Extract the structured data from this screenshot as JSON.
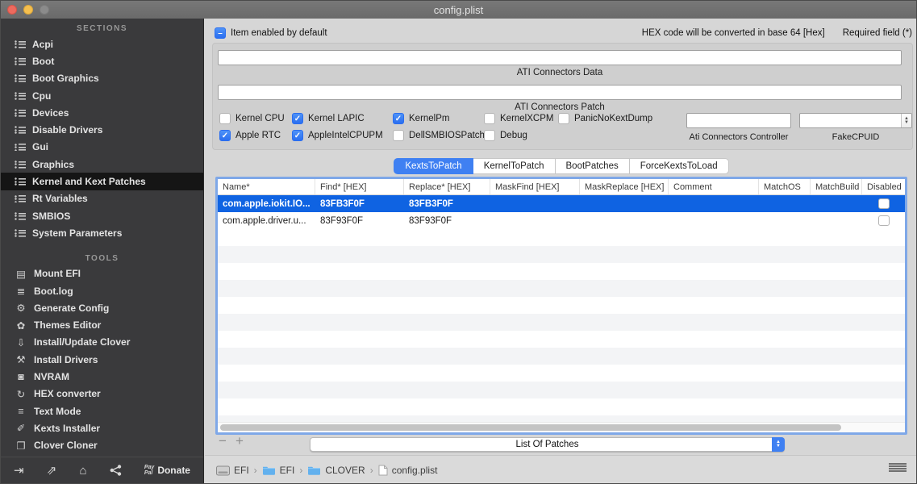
{
  "window": {
    "title": "config.plist"
  },
  "colors": {
    "accent_blue": "#3f80f2",
    "selection_blue": "#0f63e2",
    "focus_ring": "#7fa8e8",
    "sidebar_bg": "#3a3a3c",
    "sidebar_selected_bg": "#151515",
    "main_bg": "#d6d6d6",
    "folder_blue": "#63b1ee"
  },
  "sidebar": {
    "sections_header": "SECTIONS",
    "sections": [
      {
        "label": "Acpi",
        "selected": false
      },
      {
        "label": "Boot",
        "selected": false
      },
      {
        "label": "Boot Graphics",
        "selected": false
      },
      {
        "label": "Cpu",
        "selected": false
      },
      {
        "label": "Devices",
        "selected": false
      },
      {
        "label": "Disable Drivers",
        "selected": false
      },
      {
        "label": "Gui",
        "selected": false
      },
      {
        "label": "Graphics",
        "selected": false
      },
      {
        "label": "Kernel and Kext Patches",
        "selected": true
      },
      {
        "label": "Rt Variables",
        "selected": false
      },
      {
        "label": "SMBIOS",
        "selected": false
      },
      {
        "label": "System Parameters",
        "selected": false
      }
    ],
    "tools_header": "TOOLS",
    "tools": [
      {
        "label": "Mount EFI",
        "icon": "drive-icon",
        "glyph": "▤"
      },
      {
        "label": "Boot.log",
        "icon": "log-search-icon",
        "glyph": "≣"
      },
      {
        "label": "Generate Config",
        "icon": "gears-icon",
        "glyph": "⚙"
      },
      {
        "label": "Themes Editor",
        "icon": "palette-icon",
        "glyph": "✿"
      },
      {
        "label": "Install/Update Clover",
        "icon": "download-icon",
        "glyph": "⇩"
      },
      {
        "label": "Install Drivers",
        "icon": "tools-icon",
        "glyph": "⚒"
      },
      {
        "label": "NVRAM",
        "icon": "chip-icon",
        "glyph": "◙"
      },
      {
        "label": "HEX converter",
        "icon": "convert-icon",
        "glyph": "↻"
      },
      {
        "label": "Text Mode",
        "icon": "text-lines-icon",
        "glyph": "≡"
      },
      {
        "label": "Kexts Installer",
        "icon": "brush-icon",
        "glyph": "✐"
      },
      {
        "label": "Clover Cloner",
        "icon": "clone-icon",
        "glyph": "❐"
      }
    ],
    "footer": {
      "import_glyph": "⇥",
      "export_glyph": "⇗",
      "home_glyph": "⌂",
      "paypal_line1": "Pay",
      "paypal_line2": "Pal",
      "donate_label": "Donate"
    }
  },
  "header": {
    "default_checkbox_label": "Item enabled by default",
    "default_checkbox_mixed": true,
    "hint_hex": "HEX code will be converted in base 64 [Hex]",
    "hint_required": "Required field (*)"
  },
  "ati": {
    "data_label": "ATI Connectors Data",
    "data_value": "",
    "patch_label": "ATI Connectors Patch",
    "patch_value": "",
    "controller_label": "Ati Connectors Controller",
    "controller_value": "",
    "fakecpuid_label": "FakeCPUID",
    "fakecpuid_value": ""
  },
  "kernel_options": [
    {
      "label": "Kernel CPU",
      "checked": false
    },
    {
      "label": "Kernel LAPIC",
      "checked": true
    },
    {
      "label": "KernelPm",
      "checked": true
    },
    {
      "label": "KernelXCPM",
      "checked": false
    },
    {
      "label": "PanicNoKextDump",
      "checked": false
    },
    {
      "label": "Apple RTC",
      "checked": true
    },
    {
      "label": "AppleIntelCPUPM",
      "checked": true
    },
    {
      "label": "DellSMBIOSPatch",
      "checked": false
    },
    {
      "label": "Debug",
      "checked": false
    }
  ],
  "tabs": [
    {
      "label": "KextsToPatch",
      "selected": true
    },
    {
      "label": "KernelToPatch",
      "selected": false
    },
    {
      "label": "BootPatches",
      "selected": false
    },
    {
      "label": "ForceKextsToLoad",
      "selected": false
    }
  ],
  "table": {
    "columns": [
      "Name*",
      "Find* [HEX]",
      "Replace* [HEX]",
      "MaskFind [HEX]",
      "MaskReplace [HEX]",
      "Comment",
      "MatchOS",
      "MatchBuild",
      "Disabled"
    ],
    "rows": [
      {
        "name": "com.apple.iokit.IO...",
        "find": "83FB3F0F",
        "replace": "83FB3F0F",
        "maskfind": "",
        "maskreplace": "",
        "comment": "",
        "matchos": "",
        "matchbuild": "",
        "disabled": false,
        "selected": true
      },
      {
        "name": "com.apple.driver.u...",
        "find": "83F93F0F",
        "replace": "83F93F0F",
        "maskfind": "",
        "maskreplace": "",
        "comment": "",
        "matchos": "",
        "matchbuild": "",
        "disabled": false,
        "selected": false
      }
    ]
  },
  "footer_controls": {
    "remove_label": "−",
    "add_label": "+",
    "popup_value": "List Of Patches"
  },
  "statusbar": {
    "crumb1": "EFI",
    "crumb2": "EFI",
    "crumb3": "CLOVER",
    "crumb4": "config.plist"
  }
}
